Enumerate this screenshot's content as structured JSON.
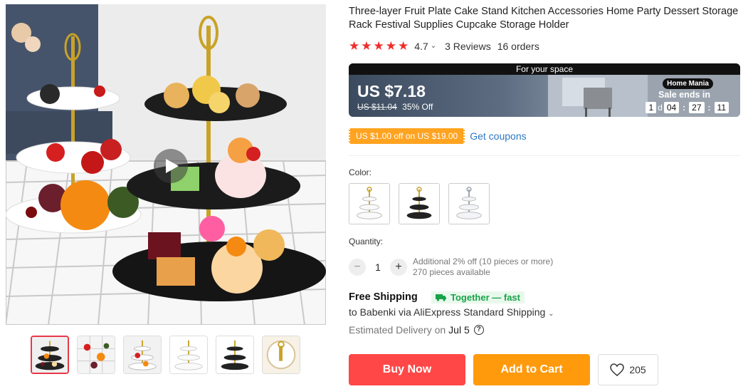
{
  "product": {
    "title": "Three-layer Fruit Plate Cake Stand Kitchen Accessories Home Party Dessert Storage Rack Festival Supplies Cupcake Storage Holder",
    "rating": "4.7",
    "reviews": "3 Reviews",
    "orders": "16 orders"
  },
  "banner": {
    "top_text": "For your space",
    "price": "US $7.18",
    "original_price": "US $11.04",
    "discount": "35% Off",
    "store_badge": "Home Mania",
    "sale_ends": "Sale ends in",
    "countdown": {
      "days": "1",
      "d_label": "d",
      "hours": "04",
      "minutes": "27",
      "seconds": "11"
    }
  },
  "coupon": {
    "chip": "US $1.00 off on US $19.00",
    "link": "Get coupons"
  },
  "color": {
    "label": "Color:",
    "options": [
      "gold-white",
      "gold-black",
      "silver-white"
    ],
    "selected": null
  },
  "quantity": {
    "label": "Quantity:",
    "value": "1",
    "minus": "−",
    "plus": "+",
    "additional": "Additional 2% off (10 pieces or more)",
    "available": "270 pieces available"
  },
  "shipping": {
    "title": "Free Shipping",
    "badge": "Together — fast",
    "line": "to Babenki via AliExpress Standard Shipping",
    "delivery_label": "Estimated Delivery on",
    "delivery_date": "Jul 5"
  },
  "actions": {
    "buy_now": "Buy Now",
    "add_to_cart": "Add to Cart",
    "wishlist_count": "205"
  },
  "colors": {
    "accent_red": "#ff4747",
    "cart_orange": "#ff9a0d",
    "coupon_orange": "#ffa320",
    "star_red": "#f02d2d",
    "link_blue": "#2b78c5",
    "together_green": "#17a34a"
  }
}
